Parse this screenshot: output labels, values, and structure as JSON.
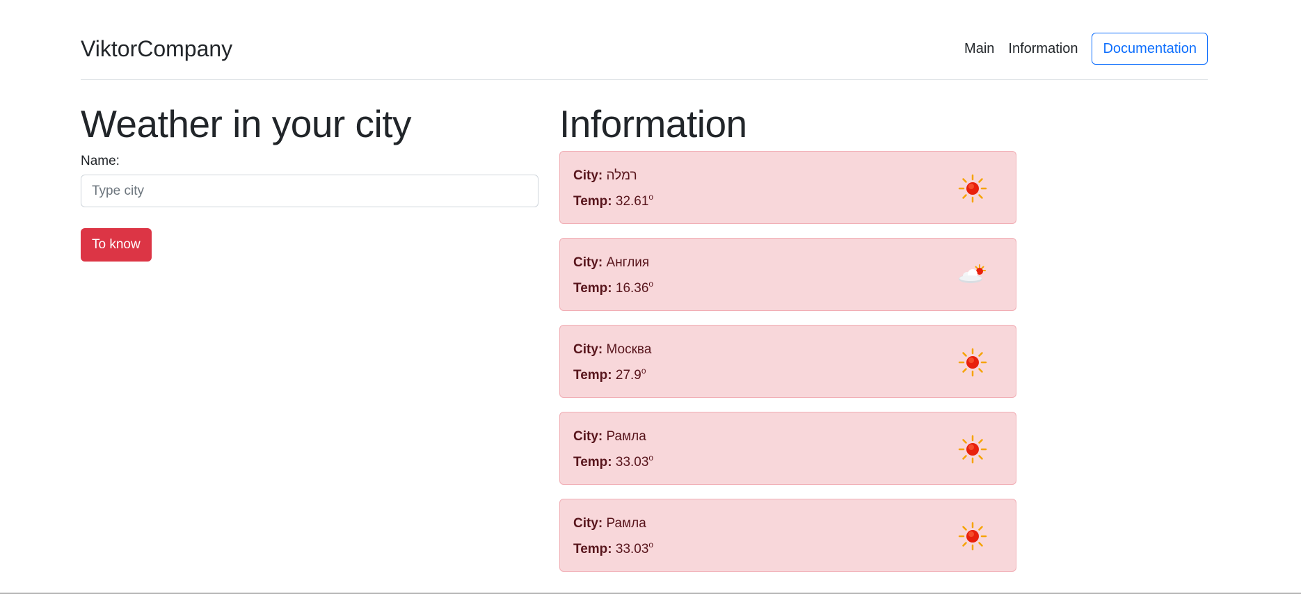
{
  "header": {
    "brand": "ViktorCompany",
    "nav": [
      "Main",
      "Information"
    ],
    "doc_button": "Documentation"
  },
  "form": {
    "title": "Weather in your city",
    "name_label": "Name:",
    "placeholder": "Type city",
    "value": "",
    "submit_label": "To know"
  },
  "info": {
    "title": "Information",
    "city_label": "City:",
    "temp_label": "Temp:",
    "degree": "o",
    "items": [
      {
        "city": "רמלה",
        "temp": "32.61",
        "icon": "sun-icon"
      },
      {
        "city": "Англия",
        "temp": "16.36",
        "icon": "cloud-sun-icon"
      },
      {
        "city": "Москва",
        "temp": "27.9",
        "icon": "sun-icon"
      },
      {
        "city": "Рамла",
        "temp": "33.03",
        "icon": "sun-icon"
      },
      {
        "city": "Рамла",
        "temp": "33.03",
        "icon": "sun-icon"
      }
    ]
  },
  "colors": {
    "primary": "#0d6efd",
    "danger": "#dc3545",
    "alert_bg": "#f8d7da",
    "alert_border": "#f1aeb5",
    "alert_text": "#58151c"
  }
}
